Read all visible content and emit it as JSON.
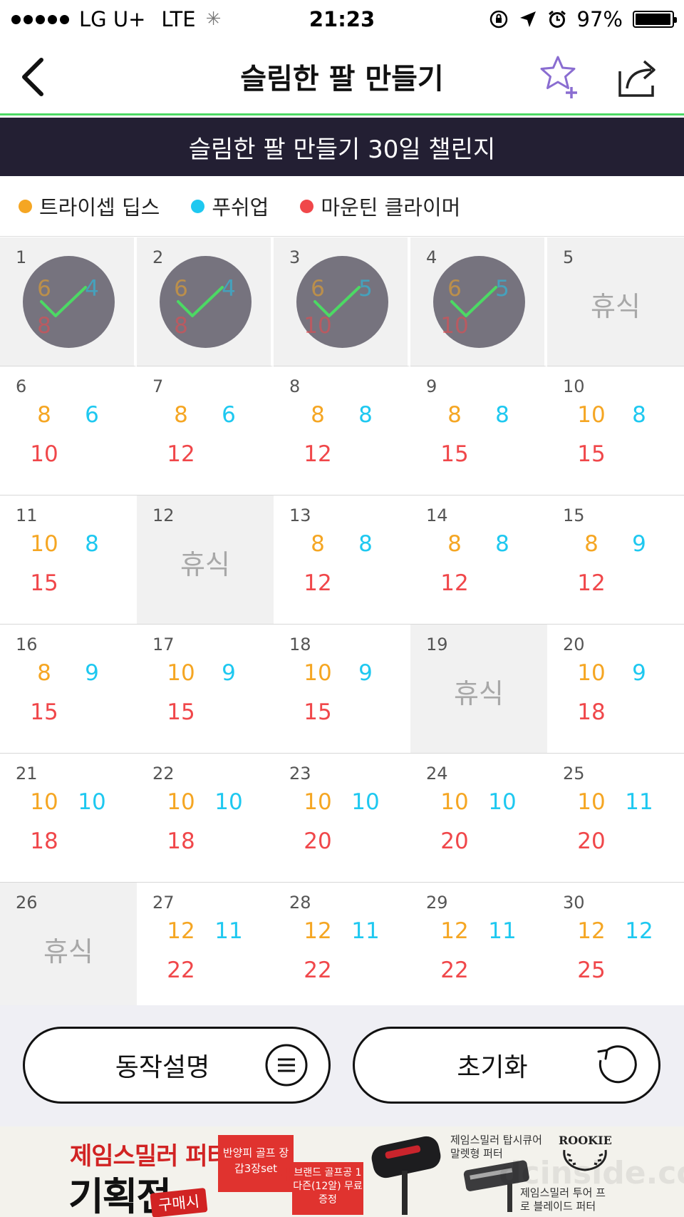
{
  "status_bar": {
    "carrier": "LG U+",
    "network": "LTE",
    "time": "21:23",
    "battery": "97%",
    "battery_level": 0.97
  },
  "nav": {
    "title": "슬림한 팔 만들기"
  },
  "banner": {
    "text": "슬림한 팔 만들기 30일 챌린지"
  },
  "legend": [
    {
      "label": "트라이셉 딥스",
      "color": "#f5a623"
    },
    {
      "label": "푸쉬업",
      "color": "#1ec8f0"
    },
    {
      "label": "마운틴 클라이머",
      "color": "#f0474a"
    }
  ],
  "colors": {
    "triceps": "#f5a623",
    "pushup": "#1ec8f0",
    "climber": "#f0474a",
    "check": "#4cd964",
    "banner_bg": "#231f33"
  },
  "rest_label": "휴식",
  "days": [
    {
      "day": "1",
      "a": "6",
      "b": "4",
      "c": "8",
      "done": true
    },
    {
      "day": "2",
      "a": "6",
      "b": "4",
      "c": "8",
      "done": true
    },
    {
      "day": "3",
      "a": "6",
      "b": "5",
      "c": "10",
      "done": true
    },
    {
      "day": "4",
      "a": "6",
      "b": "5",
      "c": "10",
      "done": true
    },
    {
      "day": "5",
      "rest": true
    },
    {
      "day": "6",
      "a": "8",
      "b": "6",
      "c": "10"
    },
    {
      "day": "7",
      "a": "8",
      "b": "6",
      "c": "12"
    },
    {
      "day": "8",
      "a": "8",
      "b": "8",
      "c": "12"
    },
    {
      "day": "9",
      "a": "8",
      "b": "8",
      "c": "15"
    },
    {
      "day": "10",
      "a": "10",
      "b": "8",
      "c": "15"
    },
    {
      "day": "11",
      "a": "10",
      "b": "8",
      "c": "15"
    },
    {
      "day": "12",
      "rest": true
    },
    {
      "day": "13",
      "a": "8",
      "b": "8",
      "c": "12"
    },
    {
      "day": "14",
      "a": "8",
      "b": "8",
      "c": "12"
    },
    {
      "day": "15",
      "a": "8",
      "b": "9",
      "c": "12"
    },
    {
      "day": "16",
      "a": "8",
      "b": "9",
      "c": "15"
    },
    {
      "day": "17",
      "a": "10",
      "b": "9",
      "c": "15"
    },
    {
      "day": "18",
      "a": "10",
      "b": "9",
      "c": "15"
    },
    {
      "day": "19",
      "rest": true
    },
    {
      "day": "20",
      "a": "10",
      "b": "9",
      "c": "18"
    },
    {
      "day": "21",
      "a": "10",
      "b": "10",
      "c": "18"
    },
    {
      "day": "22",
      "a": "10",
      "b": "10",
      "c": "18"
    },
    {
      "day": "23",
      "a": "10",
      "b": "10",
      "c": "20"
    },
    {
      "day": "24",
      "a": "10",
      "b": "10",
      "c": "20"
    },
    {
      "day": "25",
      "a": "10",
      "b": "11",
      "c": "20"
    },
    {
      "day": "26",
      "rest": true
    },
    {
      "day": "27",
      "a": "12",
      "b": "11",
      "c": "22"
    },
    {
      "day": "28",
      "a": "12",
      "b": "11",
      "c": "22"
    },
    {
      "day": "29",
      "a": "12",
      "b": "11",
      "c": "22"
    },
    {
      "day": "30",
      "a": "12",
      "b": "12",
      "c": "25"
    }
  ],
  "buttons": {
    "guide": "동작설명",
    "reset": "초기화"
  },
  "ad": {
    "title_1": "제임스밀러 퍼터",
    "title_2": "기획전",
    "stamp": "구매시",
    "tag_1": "반양피 골프 장갑3장set",
    "tag_2": "브랜드 골프공 1다즌(12알) 무료증정",
    "text_1": "제임스밀러 탑시큐어 말렛형 퍼터",
    "text_2": "제임스밀러 투어 프로 블레이드 퍼터",
    "rookie": "ROOKIE",
    "watermark": "dcinside.com"
  }
}
